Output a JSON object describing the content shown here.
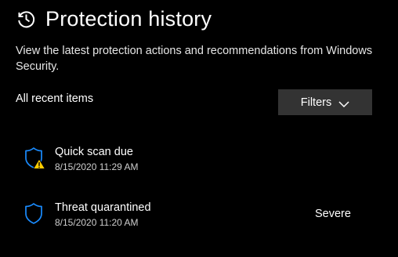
{
  "header": {
    "icon": "history-icon",
    "title": "Protection history"
  },
  "description": "View the latest protection actions and recommendations from Windows Security.",
  "list": {
    "section_label": "All recent items",
    "filters_label": "Filters"
  },
  "items": [
    {
      "icon": "shield-warning-icon",
      "title": "Quick scan due",
      "date": "8/15/2020 11:29 AM",
      "severity": ""
    },
    {
      "icon": "shield-icon",
      "title": "Threat quarantined",
      "date": "8/15/2020 11:20 AM",
      "severity": "Severe"
    }
  ],
  "colors": {
    "background": "#000000",
    "accent_blue": "#1a8cff",
    "warning_yellow": "#ffcc00",
    "button_bg": "#333333"
  }
}
